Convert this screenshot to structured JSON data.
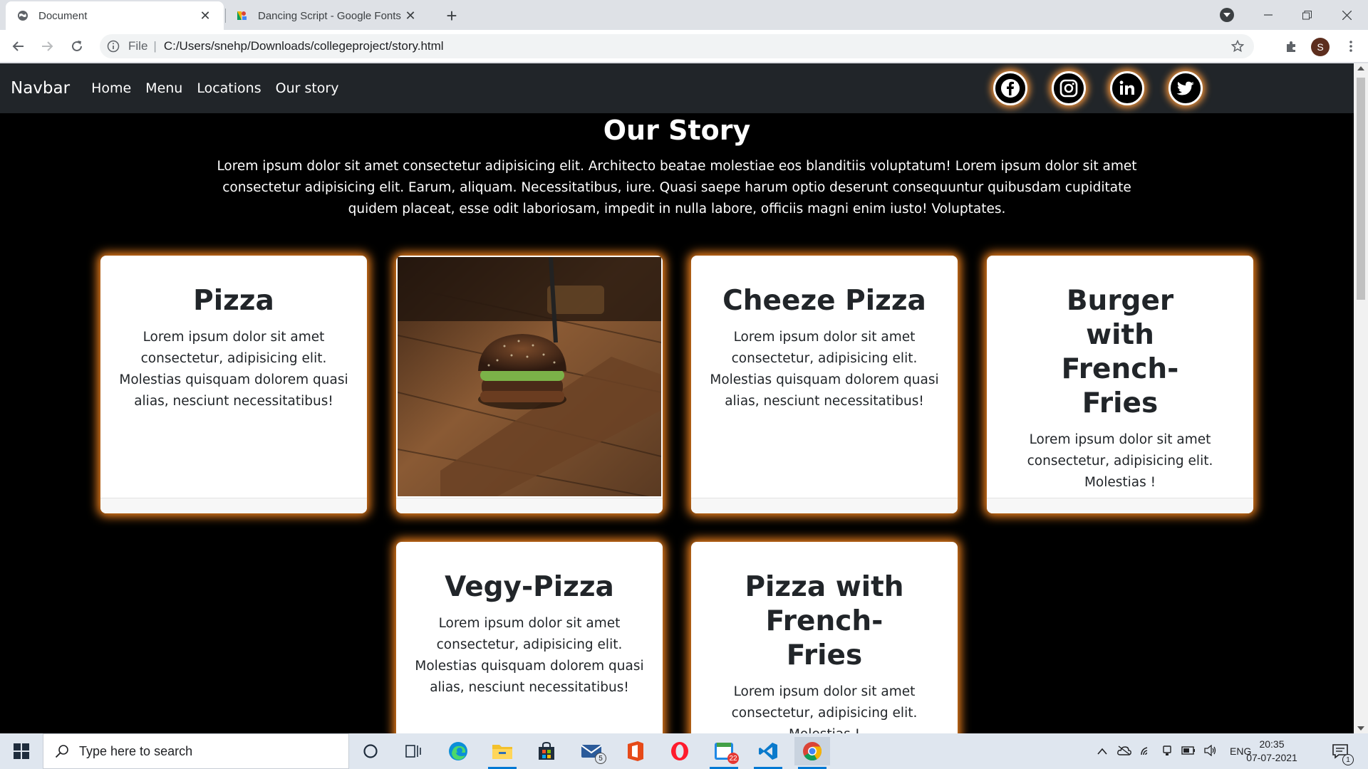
{
  "browser": {
    "tabs": [
      {
        "title": "Document",
        "active": true
      },
      {
        "title": "Dancing Script - Google Fonts",
        "active": false
      }
    ],
    "address": {
      "scheme_label": "File",
      "url": "C:/Users/snehp/Downloads/collegeproject/story.html"
    },
    "profile_initial": "S"
  },
  "page": {
    "navbar": {
      "brand": "Navbar",
      "links": [
        "Home",
        "Menu",
        "Locations",
        "Our story"
      ],
      "social": [
        "facebook-icon",
        "instagram-icon",
        "linkedin-icon",
        "twitter-icon"
      ]
    },
    "story": {
      "title": "Our Story",
      "text": "Lorem ipsum dolor sit amet consectetur adipisicing elit. Architecto beatae molestiae eos blanditiis voluptatum! Lorem ipsum dolor sit amet consectetur adipisicing elit. Earum, aliquam. Necessitatibus, iure. Quasi saepe harum optio deserunt consequuntur quibusdam cupiditate quidem placeat, esse odit laboriosam, impedit in nulla labore, officiis magni enim iusto! Voluptates."
    },
    "cards": [
      {
        "title": "Pizza",
        "text": "Lorem ipsum dolor sit amet consectetur, adipisicing elit. Molestias quisquam dolorem quasi alias, nesciunt necessitatibus!"
      },
      {
        "image": "burger-photo"
      },
      {
        "title": "Cheeze Pizza",
        "text": "Lorem ipsum dolor sit amet consectetur, adipisicing elit. Molestias quisquam dolorem quasi alias, nesciunt necessitatibus!"
      },
      {
        "title": "Burger with French-Fries",
        "text": "Lorem ipsum dolor sit amet consectetur, adipisicing elit. Molestias !"
      },
      {
        "title": "Vegy-Pizza",
        "text": "Lorem ipsum dolor sit amet consectetur, adipisicing elit. Molestias quisquam dolorem quasi alias, nesciunt necessitatibus!"
      },
      {
        "title": "Pizza with French-Fries",
        "text": "Lorem ipsum dolor sit amet consectetur, adipisicing elit. Molestias !"
      }
    ],
    "colors": {
      "navbar_bg": "#212529",
      "glow": "#ff8a1f",
      "page_bg": "#000000"
    }
  },
  "taskbar": {
    "search_placeholder": "Type here to search",
    "mail_badge": "5",
    "calendar_badge": "22",
    "language": "ENG",
    "time": "20:35",
    "date": "07-07-2021",
    "notification_count": "1"
  }
}
